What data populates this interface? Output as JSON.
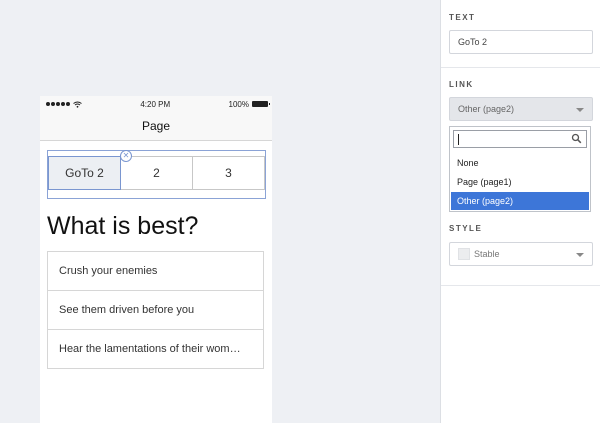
{
  "phone": {
    "status": {
      "time": "4:20 PM",
      "battery": "100%"
    },
    "title": "Page",
    "segments": [
      "GoTo 2",
      "2",
      "3"
    ],
    "heading": "What is best?",
    "list": [
      "Crush your enemies",
      "See them driven before you",
      "Hear the lamentations of their wom…"
    ]
  },
  "panel": {
    "text": {
      "label": "TEXT",
      "value": "GoTo 2"
    },
    "link": {
      "label": "LINK",
      "value": "Other (page2)",
      "search_value": "",
      "options": [
        "None",
        "Page (page1)",
        "Other (page2)"
      ],
      "selected_index": 2
    },
    "style": {
      "label": "STYLE",
      "value": "Stable"
    }
  },
  "colors": {
    "accent": "#3d76d8",
    "selection_outline": "#7a96d0"
  }
}
